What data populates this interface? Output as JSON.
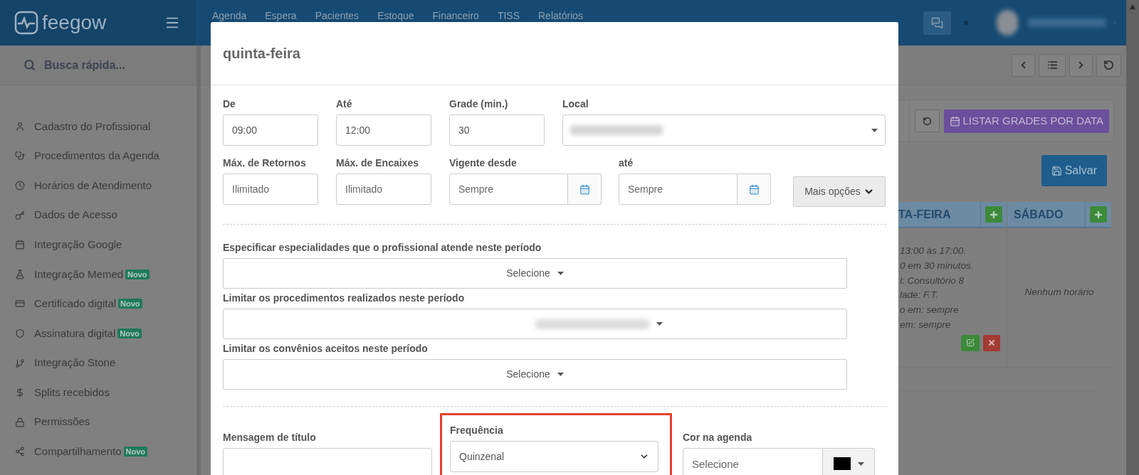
{
  "header": {
    "logo": "feegow",
    "nav": [
      "Agenda",
      "Espera",
      "Pacientes",
      "Estoque",
      "Financeiro",
      "TISS",
      "Relatórios"
    ]
  },
  "sidebar": {
    "search_placeholder": "Busca rápida...",
    "items": [
      {
        "label": "Cadastro do Profissional"
      },
      {
        "label": "Procedimentos da Agenda"
      },
      {
        "label": "Horários de Atendimento"
      },
      {
        "label": "Dados de Acesso"
      },
      {
        "label": "Integração Google"
      },
      {
        "label": "Integração Memed",
        "badge": "Novo"
      },
      {
        "label": "Certificado digital",
        "badge": "Novo"
      },
      {
        "label": "Assinatura digital",
        "badge": "Novo"
      },
      {
        "label": "Integração Stone"
      },
      {
        "label": "Splits recebidos"
      },
      {
        "label": "Permissões"
      },
      {
        "label": "Compartilhamento",
        "badge": "Novo"
      }
    ]
  },
  "schedule": {
    "list_button": "LISTAR GRADES POR DATA",
    "save_button": "Salvar",
    "columns": [
      {
        "day": "TA-FEIRA",
        "lines": [
          "13:00 às 17:00.",
          "0 em 30 minutos.",
          "l: Consultório 8",
          "lade: F.T.",
          "o em: sempre",
          "em: sempre"
        ]
      },
      {
        "day": "SÁBADO",
        "empty": "Nenhum horário"
      }
    ]
  },
  "modal": {
    "title": "quinta-feira",
    "row1": [
      {
        "label": "De",
        "value": "09:00"
      },
      {
        "label": "Até",
        "value": "12:00"
      },
      {
        "label": "Grade (min.)",
        "value": "30"
      }
    ],
    "local_label": "Local",
    "row2": [
      {
        "label": "Máx. de Retornos",
        "placeholder": "Ilimitado"
      },
      {
        "label": "Máx. de Encaixes",
        "placeholder": "Ilimitado"
      }
    ],
    "dates": [
      {
        "label": "Vigente desde",
        "placeholder": "Sempre"
      },
      {
        "label": "até",
        "placeholder": "Sempre"
      }
    ],
    "more_button": "Mais opções",
    "multiselects": [
      {
        "label": "Especificar especialidades que o profissional atende neste período",
        "kind": "select",
        "value": "Selecione"
      },
      {
        "label": "Limitar os procedimentos realizados neste período",
        "kind": "redacted"
      },
      {
        "label": "Limitar os convênios aceitos neste período",
        "kind": "select",
        "value": "Selecione"
      }
    ],
    "title_message": {
      "label": "Mensagem de título"
    },
    "frequency": {
      "label": "Frequência",
      "value": "Quinzenal",
      "highlighted": true
    },
    "agenda_color": {
      "label": "Cor na agenda",
      "placeholder": "Selecione",
      "color": "#000000"
    }
  }
}
